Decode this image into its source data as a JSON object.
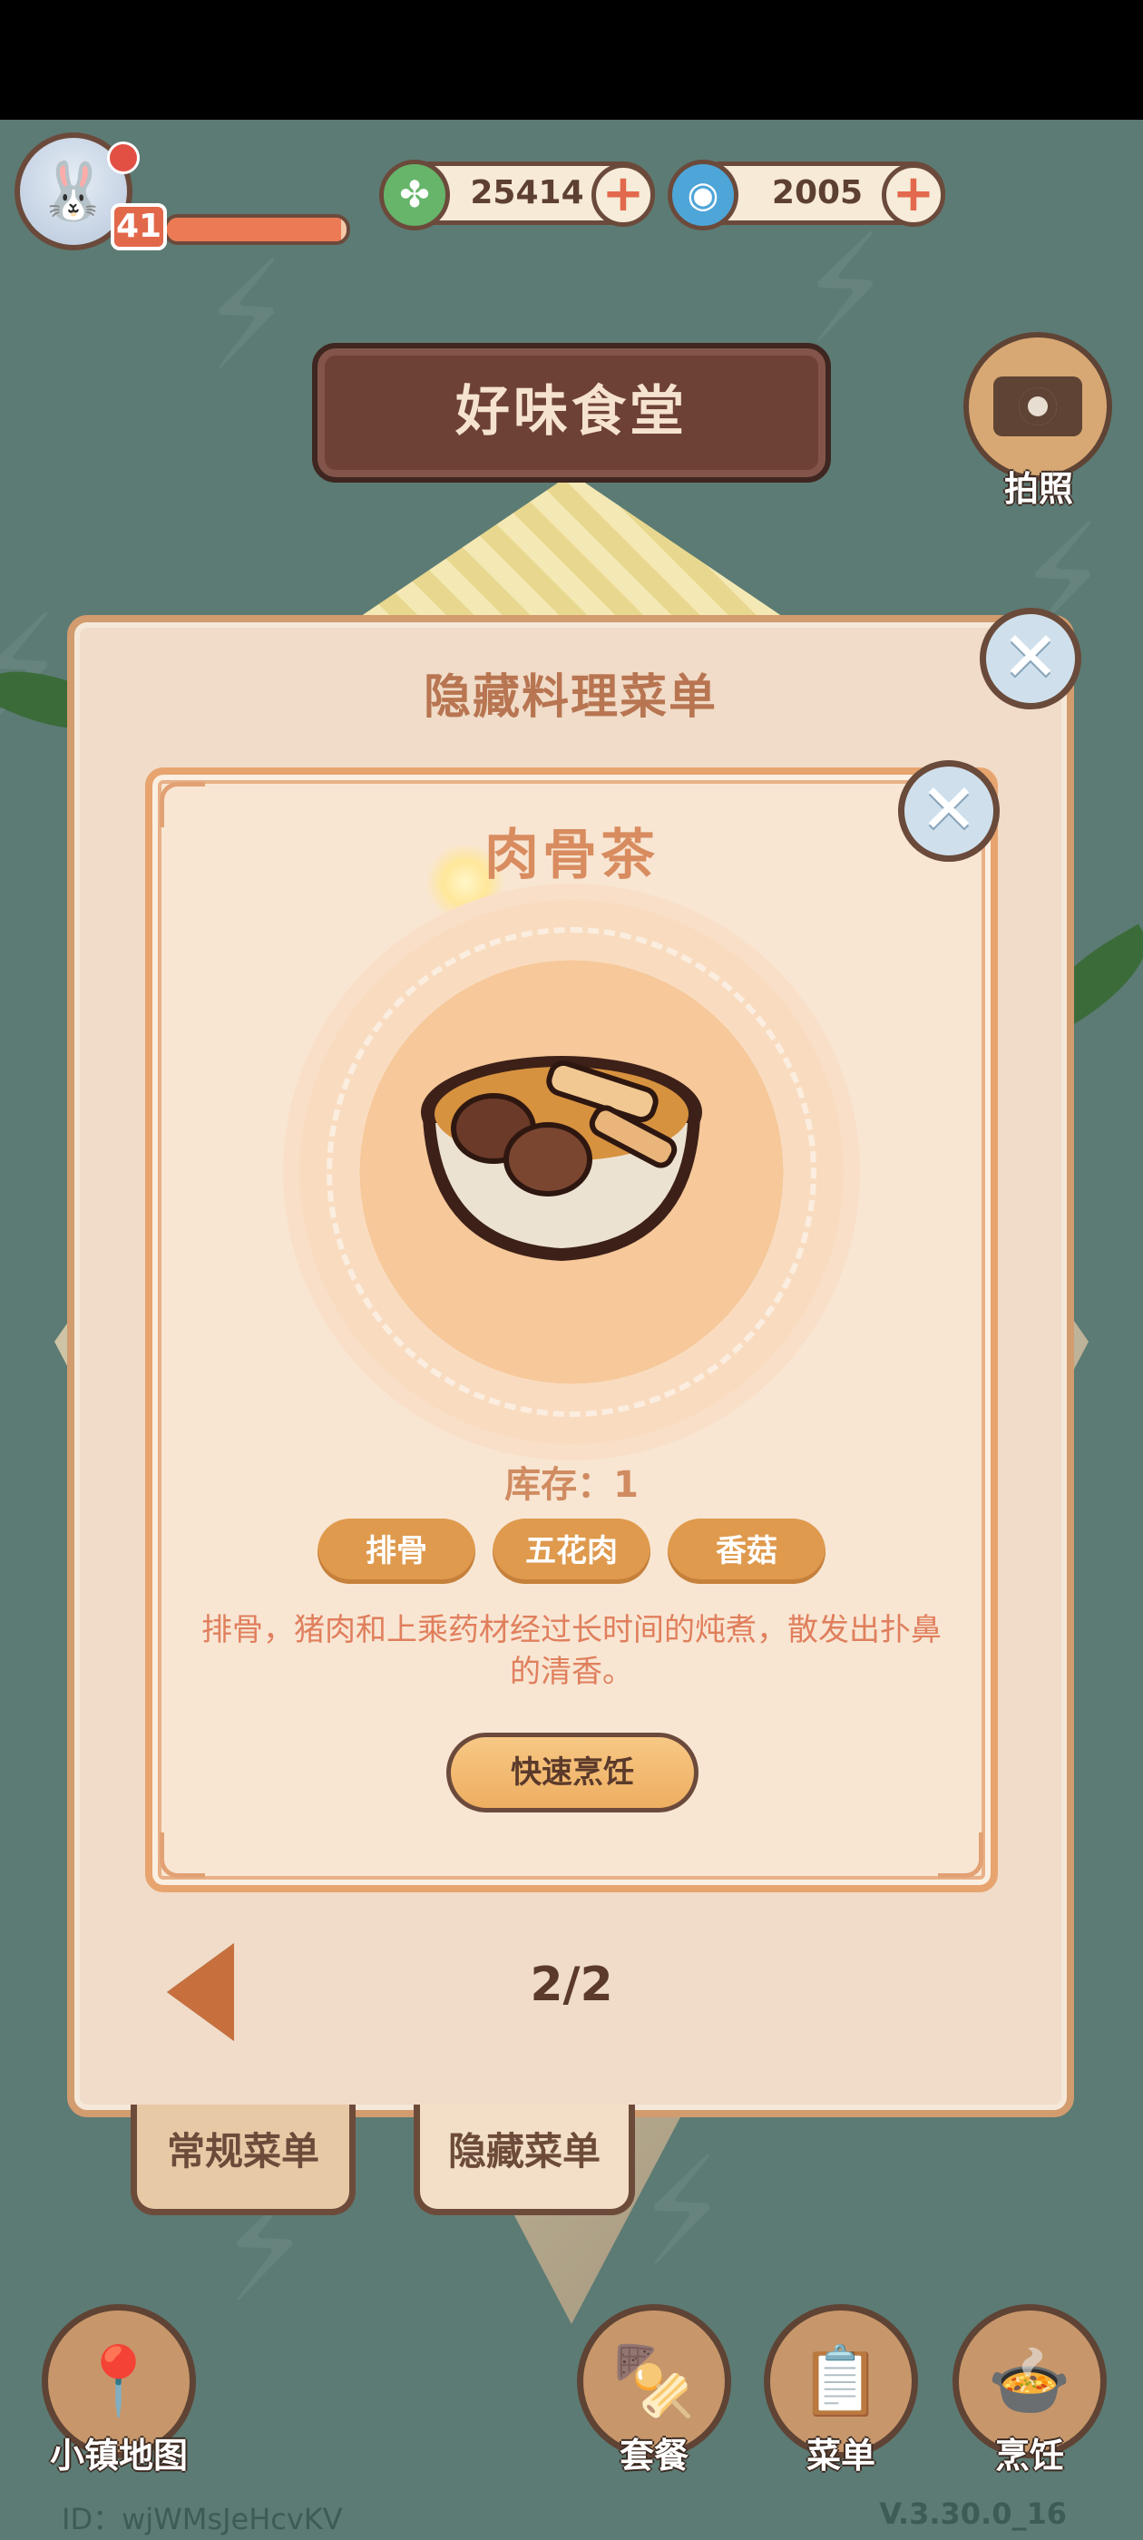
{
  "hud": {
    "level": "41",
    "xp_fraction": 0.97,
    "currency_clover": "25414",
    "currency_spiral": "2005",
    "plus_label": "+"
  },
  "restaurant_name": "好味食堂",
  "camera_label": "拍照",
  "outer_panel": {
    "title": "隐藏料理菜单",
    "close_label": "✕",
    "page_indicator": "2/2",
    "tabs": [
      "常规菜单",
      "隐藏菜单"
    ]
  },
  "dish": {
    "name": "肉骨茶",
    "stock_text": "库存：1",
    "ingredients": [
      "排骨",
      "五花肉",
      "香菇"
    ],
    "description": "排骨，猪肉和上乘药材经过长时间的炖煮，散发出扑鼻的清香。",
    "cook_button": "快速烹饪",
    "close_label": "✕"
  },
  "bottom_nav": {
    "map": "小镇地图",
    "set_meal": "套餐",
    "menu": "菜单",
    "cook": "烹饪"
  },
  "footer": {
    "id": "ID：wjWMsJeHcvKV",
    "version": "V.3.30.0_16"
  },
  "icons": {
    "clover": "clover-icon",
    "spiral": "spiral-icon",
    "camera": "camera-icon",
    "map_pin": "map-pin-icon",
    "skewer": "skewer-icon",
    "clipboard": "clipboard-icon",
    "pot": "pot-icon"
  },
  "colors": {
    "accent_orange": "#df9a4e",
    "title_brown": "#6d4136",
    "text_orange": "#e07f5d"
  }
}
